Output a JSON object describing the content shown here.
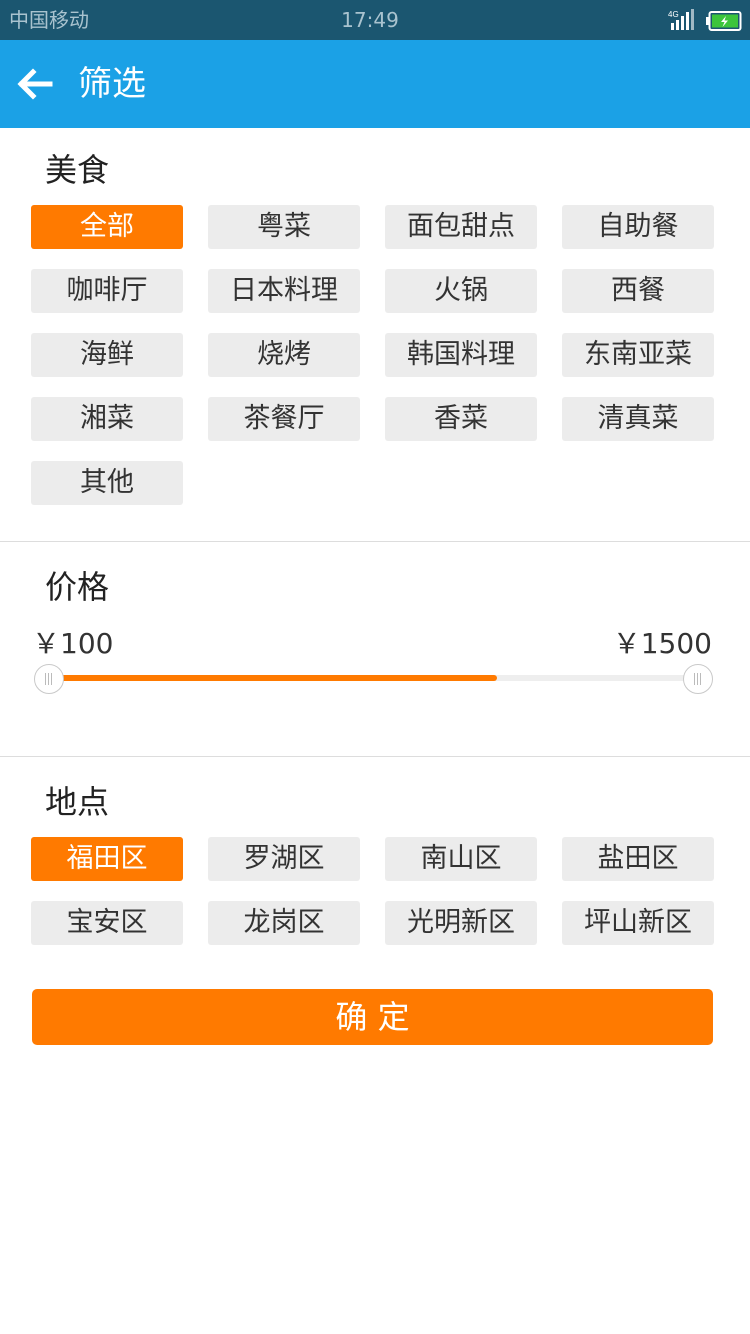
{
  "status_bar": {
    "carrier": "中国移动",
    "time": "17:49",
    "network": "4G"
  },
  "header": {
    "title": "筛选",
    "back_icon": "arrow-left-icon"
  },
  "food": {
    "title": "美食",
    "items": [
      {
        "label": "全部",
        "selected": true
      },
      {
        "label": "粤菜",
        "selected": false
      },
      {
        "label": "面包甜点",
        "selected": false
      },
      {
        "label": "自助餐",
        "selected": false
      },
      {
        "label": "咖啡厅",
        "selected": false
      },
      {
        "label": "日本料理",
        "selected": false
      },
      {
        "label": "火锅",
        "selected": false
      },
      {
        "label": "西餐",
        "selected": false
      },
      {
        "label": "海鲜",
        "selected": false
      },
      {
        "label": "烧烤",
        "selected": false
      },
      {
        "label": "韩国料理",
        "selected": false
      },
      {
        "label": "东南亚菜",
        "selected": false
      },
      {
        "label": "湘菜",
        "selected": false
      },
      {
        "label": "茶餐厅",
        "selected": false
      },
      {
        "label": "香菜",
        "selected": false
      },
      {
        "label": "清真菜",
        "selected": false
      },
      {
        "label": "其他",
        "selected": false
      }
    ]
  },
  "price": {
    "title": "价格",
    "min_label": "￥100",
    "max_label": "￥1500",
    "fill_fraction": 0.69
  },
  "location": {
    "title": "地点",
    "items": [
      {
        "label": "福田区",
        "selected": true
      },
      {
        "label": "罗湖区",
        "selected": false
      },
      {
        "label": "南山区",
        "selected": false
      },
      {
        "label": "盐田区",
        "selected": false
      },
      {
        "label": "宝安区",
        "selected": false
      },
      {
        "label": "龙岗区",
        "selected": false
      },
      {
        "label": "光明新区",
        "selected": false
      },
      {
        "label": "坪山新区",
        "selected": false
      }
    ]
  },
  "confirm_label": "确 定",
  "colors": {
    "status_bar": "#1b5670",
    "app_bar": "#1ba1e6",
    "accent": "#ff7a00",
    "chip_background": "#ececec"
  }
}
